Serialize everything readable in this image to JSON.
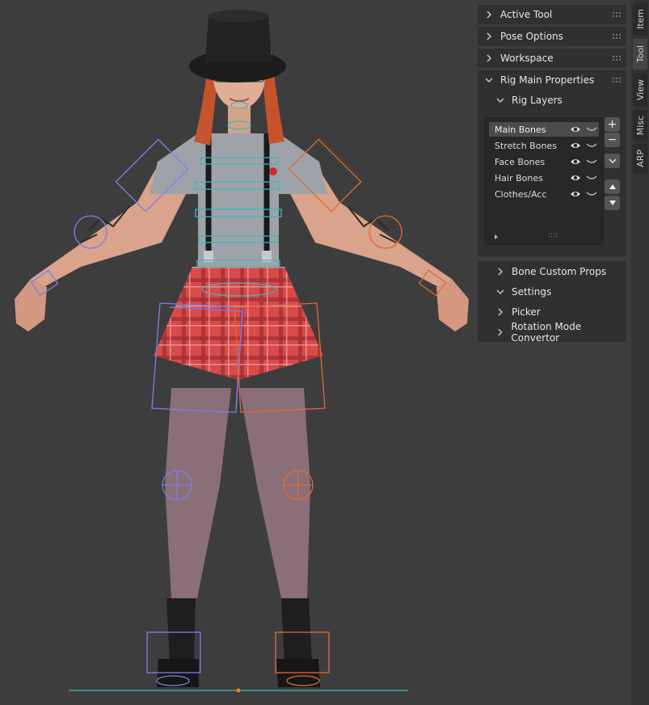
{
  "panel": {
    "active_tool": "Active Tool",
    "pose_options": "Pose Options",
    "workspace": "Workspace",
    "rig_main_properties": "Rig Main Properties",
    "rig_layers": "Rig Layers",
    "bone_custom_props": "Bone Custom Props",
    "settings": "Settings",
    "picker": "Picker",
    "rotation_mode_convertor": "Rotation Mode Convertor"
  },
  "layers": [
    {
      "label": "Main Bones",
      "active": true
    },
    {
      "label": "Stretch Bones",
      "active": false
    },
    {
      "label": "Face Bones",
      "active": false
    },
    {
      "label": "Hair Bones",
      "active": false
    },
    {
      "label": "Clothes/Acc",
      "active": false
    }
  ],
  "list_buttons": {
    "add": "+",
    "remove": "−",
    "grip": "::::"
  },
  "tabs": [
    "Item",
    "Tool",
    "View",
    "Misc",
    "ARP"
  ],
  "active_tab": "Tool",
  "colors": {
    "background": "#3d3d3d",
    "panel": "#303030",
    "bone_left": "#7b7fe6",
    "bone_right": "#e06a32",
    "bone_center": "#3fb7b7"
  },
  "viewport": {
    "subject": "3D character rig in pose mode"
  }
}
